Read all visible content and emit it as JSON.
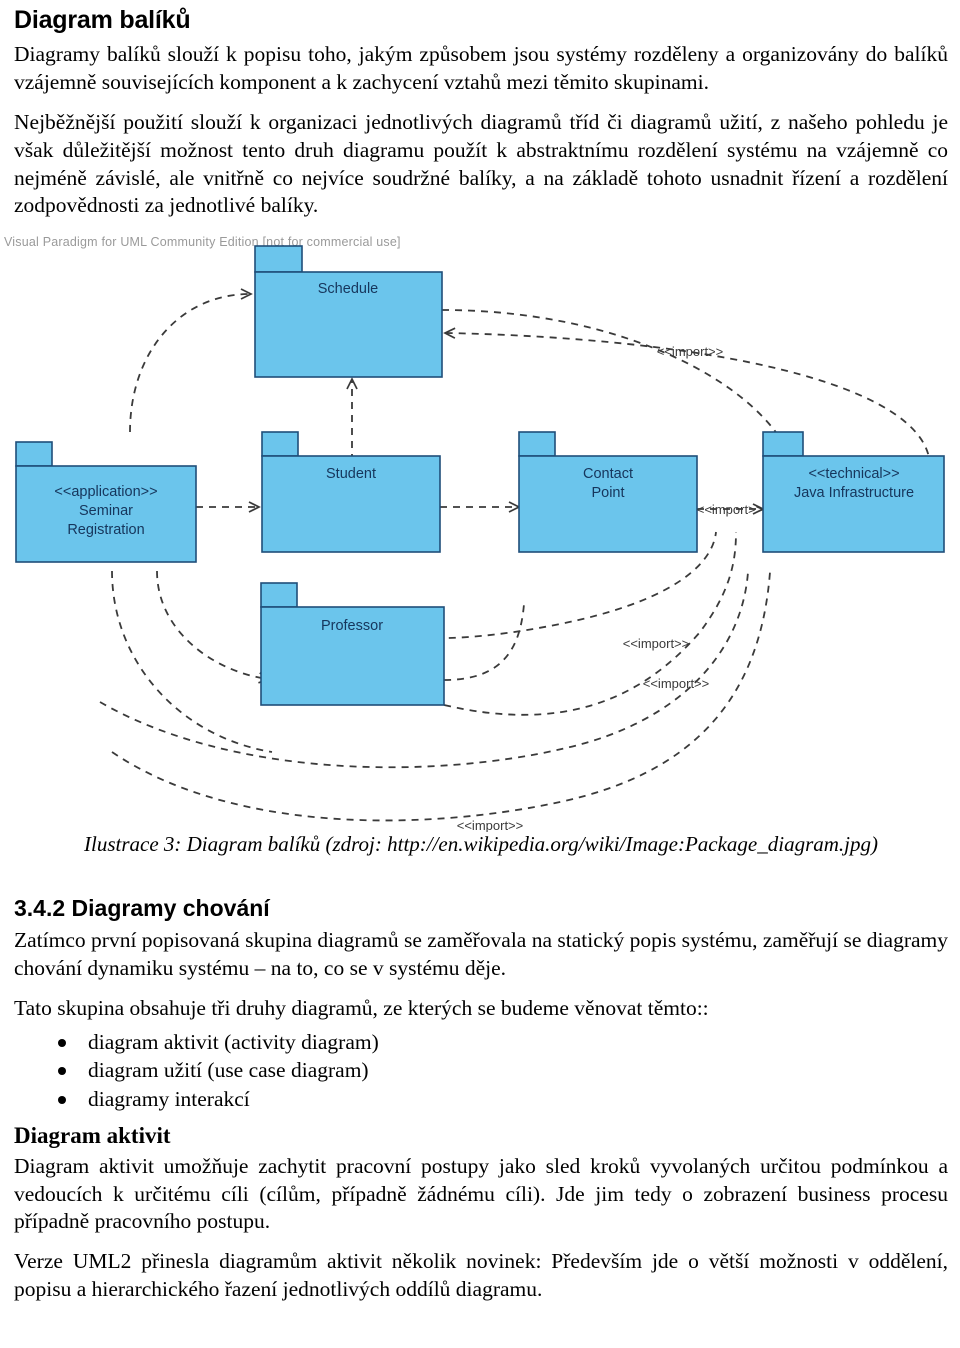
{
  "document": {
    "heading_1": "Diagram balíků",
    "paragraph_1": "Diagramy balíků slouží k popisu toho, jakým způsobem jsou systémy rozděleny a organizovány do balíků vzájemně souvisejících komponent a k zachycení vztahů mezi těmito skupinami.",
    "paragraph_2": "Nejběžnější použití slouží k organizaci jednotlivých diagramů tříd či diagramů užití, z našeho pohledu je však důležitější možnost tento druh diagramu použít k abstraktnímu rozdělení systému na vzájemně co nejméně závislé, ale vnitřně co nejvíce soudržné balíky, a na základě tohoto usnadnit řízení a rozdělení zodpovědnosti za jednotlivé balíky.",
    "figure_caption": "Ilustrace 3: Diagram balíků (zdroj: http://en.wikipedia.org/wiki/Image:Package_diagram.jpg)",
    "heading_2": "3.4.2 Diagramy chování",
    "paragraph_3": "Zatímco první popisovaná skupina diagramů se zaměřovala na statický popis systému, zaměřují se diagramy chování dynamiku systému – na to, co se v systému děje.",
    "paragraph_4": "Tato skupina obsahuje tři druhy diagramů, ze kterých se budeme věnovat těmto::",
    "bullets": [
      "diagram aktivit (activity diagram)",
      "diagram užití (use case diagram)",
      "diagramy interakcí"
    ],
    "heading_3": "Diagram aktivit",
    "paragraph_5": "Diagram aktivit umožňuje zachytit pracovní postupy jako sled kroků vyvolaných určitou podmínkou a vedoucích k určitému cíli (cílům, případně žádnému cíli). Jde jim tedy o zobrazení business procesu případně pracovního postupu.",
    "paragraph_6": "Verze UML2 přinesla diagramům aktivit několik novinek: Především jde o větší možnosti v oddělení, popisu a hierarchického řazení jednotlivých oddílů diagramu."
  },
  "figure": {
    "watermark": "Visual Paradigm for UML Community Edition [not for commercial use]",
    "colors": {
      "package_fill": "#6BC5EC",
      "package_stroke": "#1F4E79",
      "label_text": "#16365C",
      "link_stroke": "#3A3A3A",
      "watermark_text": "#9a9a9a"
    },
    "packages": [
      {
        "id": "schedule",
        "label_line_1": "Schedule",
        "label_line_2": ""
      },
      {
        "id": "seminar",
        "label_line_1": "<<application>>",
        "label_line_2": "Seminar",
        "label_line_3": "Registration"
      },
      {
        "id": "student",
        "label_line_1": "Student",
        "label_line_2": ""
      },
      {
        "id": "contact",
        "label_line_1": "Contact",
        "label_line_2": "Point"
      },
      {
        "id": "java",
        "label_line_1": "<<technical>>",
        "label_line_2": "Java Infrastructure"
      },
      {
        "id": "professor",
        "label_line_1": "Professor",
        "label_line_2": ""
      }
    ],
    "relationship_labels": [
      "<<import>>",
      "<<import>>",
      "<<import>>",
      "<<import>>",
      "<<import>>"
    ]
  }
}
